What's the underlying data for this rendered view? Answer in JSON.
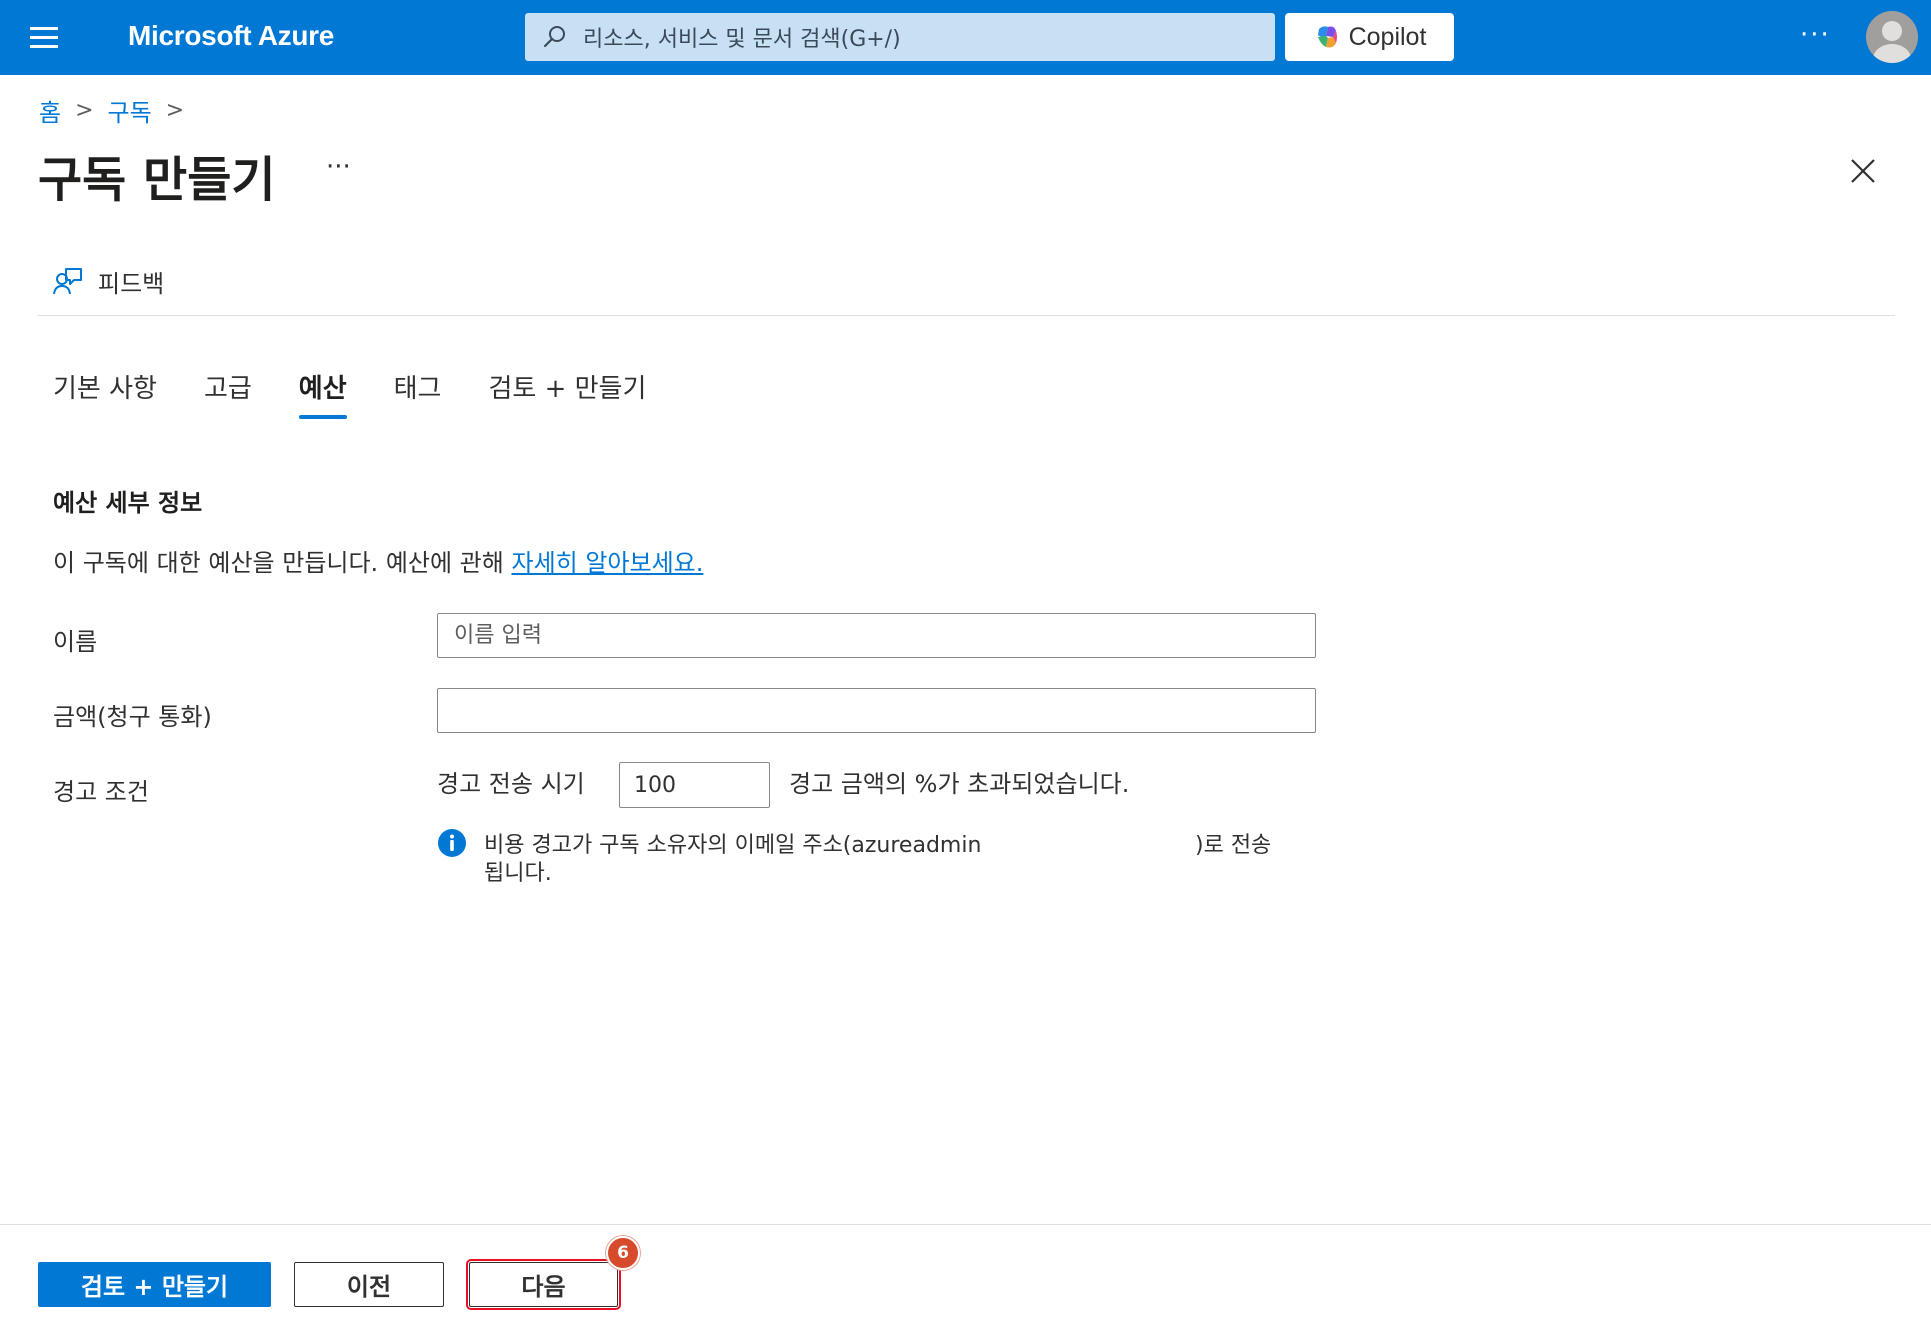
{
  "topbar": {
    "brand": "Microsoft Azure",
    "search_placeholder": "리소스, 서비스 및 문서 검색(G+/)",
    "copilot_label": "Copilot",
    "more_label": "···"
  },
  "breadcrumb": {
    "items": [
      "홈",
      "구독"
    ],
    "separator": ">"
  },
  "page": {
    "title": "구독 만들기",
    "more_label": "···"
  },
  "feedback": {
    "label": "피드백"
  },
  "tabs": [
    {
      "label": "기본 사항",
      "active": false
    },
    {
      "label": "고급",
      "active": false
    },
    {
      "label": "예산",
      "active": true
    },
    {
      "label": "태그",
      "active": false
    },
    {
      "label": "검토 + 만들기",
      "active": false
    }
  ],
  "budget": {
    "section_title": "예산 세부 정보",
    "description": "이 구독에 대한 예산을 만듭니다. 예산에 관해",
    "learn_more": "자세히 알아보세요.",
    "name_label": "이름",
    "name_placeholder": "이름 입력",
    "name_value": "",
    "amount_label": "금액(청구 통화)",
    "amount_value": "",
    "alert_label": "경고 조건",
    "alert_when": "경고 전송 시기",
    "threshold_value": "100",
    "alert_suffix": "경고 금액의 %가 초과되었습니다.",
    "info_part1": "비용 경고가 구독 소유자의 이메일 주소(azureadmin",
    "info_part2": ")로 전송",
    "info_part3": "됩니다."
  },
  "footer": {
    "review_create": "검토 + 만들기",
    "previous": "이전",
    "next": "다음",
    "step_badge": "6"
  },
  "colors": {
    "accent": "#0078d4",
    "highlight": "#e81123",
    "badge": "#d74b2d"
  }
}
